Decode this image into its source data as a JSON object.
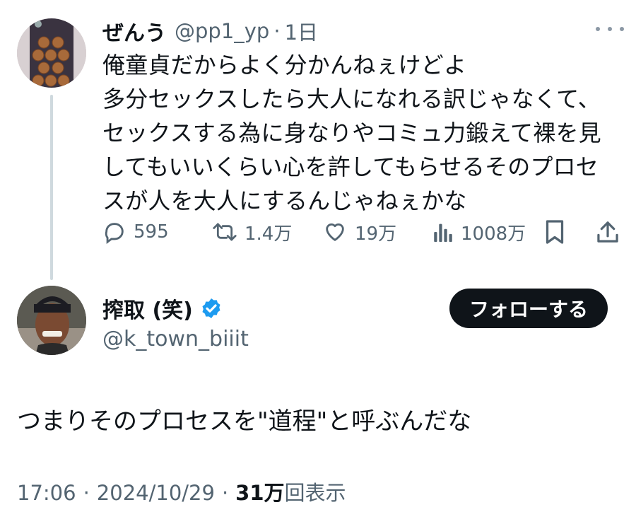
{
  "tweet": {
    "display_name": "ぜんう",
    "handle": "@pp1_yp",
    "separator": "·",
    "time": "1日",
    "more_icon": "more-dots-icon",
    "text_lines": [
      "俺童貞だからよく分かんねぇけどよ",
      "多分セックスしたら大人になれる訳じゃなくて、",
      "セックスする為に身なりやコミュ力鍛えて裸を見",
      "してもいいくらい心を許してもらせるそのプロセ",
      "スが人を大人にするんじゃねぇかな"
    ],
    "actions": {
      "replies": "595",
      "retweets": "1.4万",
      "likes": "19万",
      "views": "1008万"
    }
  },
  "reply": {
    "display_name": "搾取 (笑)",
    "verified_badge_color": "#1d9bf0",
    "handle": "@k_town_biiit",
    "follow_label": "フォローする",
    "text": "つまりそのプロセスを\"道程\"と呼ぶんだな",
    "timestamp": "17:06",
    "date": "2024/10/29",
    "separator": "·",
    "views_count": "31万",
    "views_label": "回表示"
  },
  "colors": {
    "text": "#0f1419",
    "secondary": "#536471",
    "thread_line": "#cfd9de",
    "follow_bg": "#0f1419"
  }
}
